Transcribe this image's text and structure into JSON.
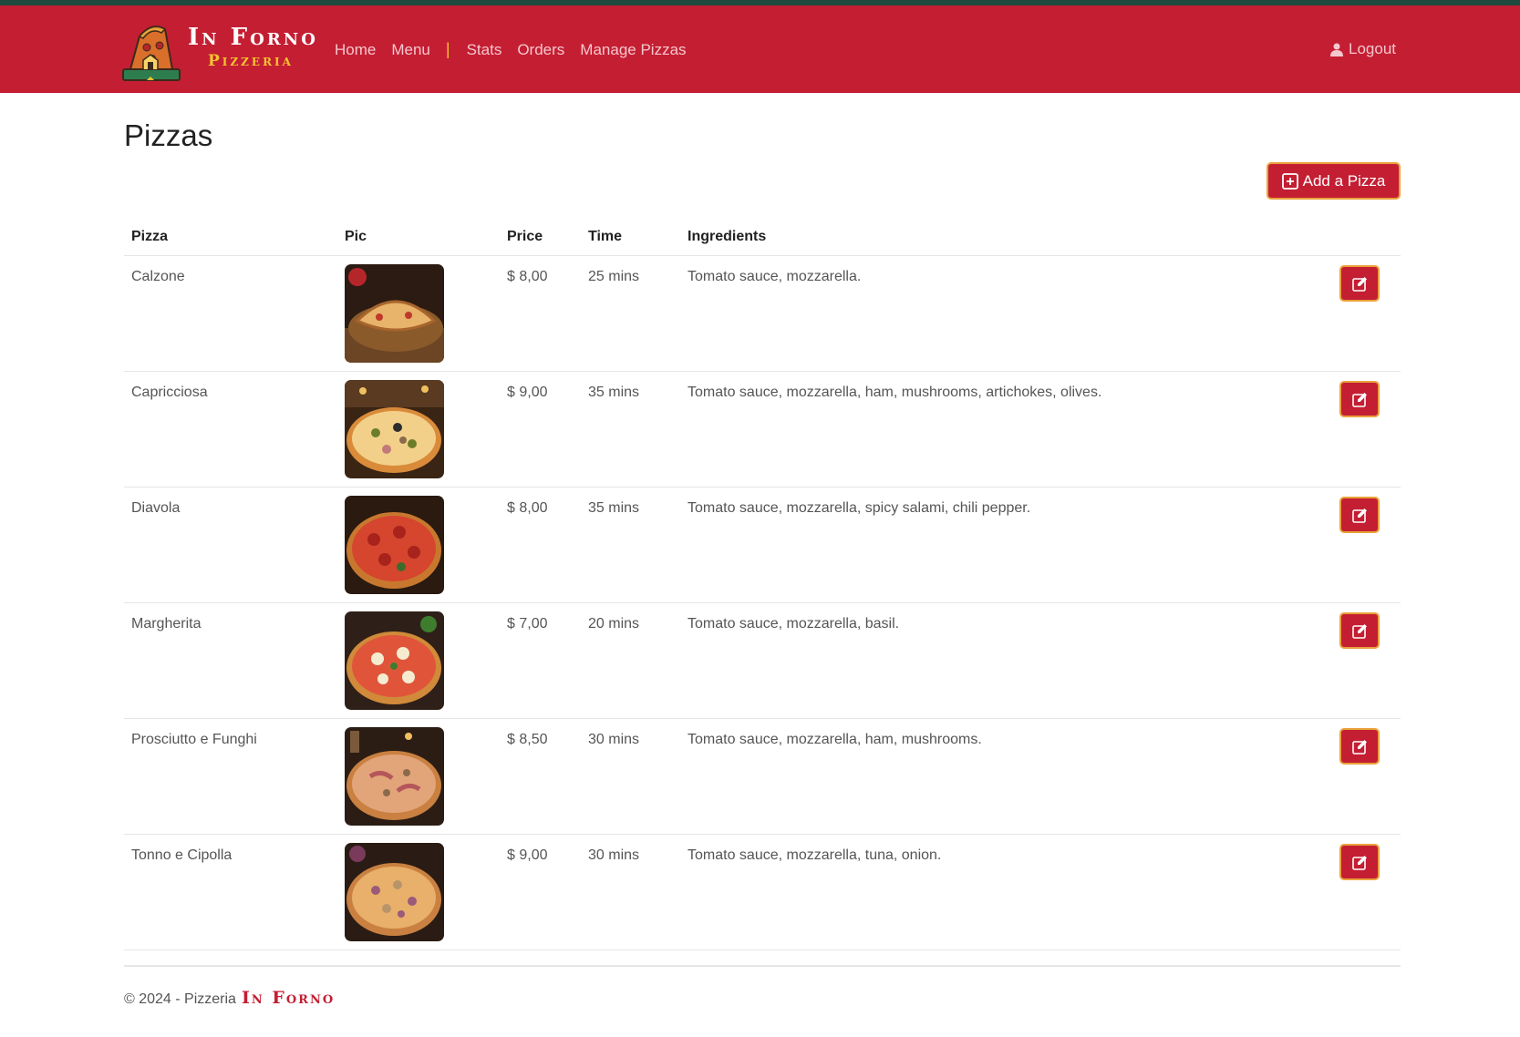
{
  "brand": {
    "name": "In Forno",
    "subtitle": "Pizzeria"
  },
  "nav": {
    "home": "Home",
    "menu": "Menu",
    "separator": "|",
    "stats": "Stats",
    "orders": "Orders",
    "manage": "Manage Pizzas"
  },
  "logout": {
    "label": "Logout",
    "icon": "user-icon"
  },
  "page": {
    "title": "Pizzas",
    "add_button": "Add a Pizza"
  },
  "table": {
    "headers": {
      "pizza": "Pizza",
      "pic": "Pic",
      "price": "Price",
      "time": "Time",
      "ingredients": "Ingredients"
    },
    "rows": [
      {
        "name": "Calzone",
        "price": "$ 8,00",
        "time": "25 mins",
        "ingredients": "Tomato sauce, mozzarella."
      },
      {
        "name": "Capricciosa",
        "price": "$ 9,00",
        "time": "35 mins",
        "ingredients": "Tomato sauce, mozzarella, ham, mushrooms, artichokes, olives."
      },
      {
        "name": "Diavola",
        "price": "$ 8,00",
        "time": "35 mins",
        "ingredients": "Tomato sauce, mozzarella, spicy salami, chili pepper."
      },
      {
        "name": "Margherita",
        "price": "$ 7,00",
        "time": "20 mins",
        "ingredients": "Tomato sauce, mozzarella, basil."
      },
      {
        "name": "Prosciutto e Funghi",
        "price": "$ 8,50",
        "time": "30 mins",
        "ingredients": "Tomato sauce, mozzarella, ham, mushrooms."
      },
      {
        "name": "Tonno e Cipolla",
        "price": "$ 9,00",
        "time": "30 mins",
        "ingredients": "Tomato sauce, mozzarella, tuna, onion."
      }
    ]
  },
  "footer": {
    "copyright": "© 2024 - Pizzeria",
    "brand": "In Forno"
  },
  "colors": {
    "primary": "#c41e33",
    "accent": "#f4c430",
    "border": "#e9a23b",
    "top_strip": "#1f4a3e"
  }
}
